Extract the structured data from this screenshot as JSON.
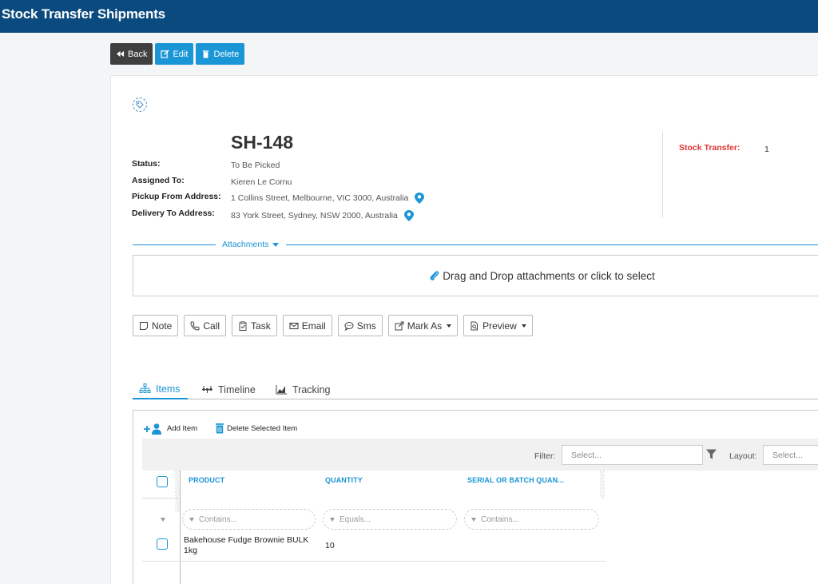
{
  "header": {
    "title": "Stock Transfer Shipments"
  },
  "actions": {
    "back": "Back",
    "edit": "Edit",
    "delete": "Delete"
  },
  "record": {
    "number": "SH-148",
    "fields": [
      {
        "label": "Status:",
        "value": "To Be Picked"
      },
      {
        "label": "Assigned To:",
        "value": "Kieren Le Cornu"
      },
      {
        "label": "Pickup From Address:",
        "value": "1 Collins Street, Melbourne, VIC 3000, Australia"
      },
      {
        "label": "Delivery To Address:",
        "value": "83 York Street, Sydney, NSW 2000, Australia"
      }
    ],
    "stock_transfer": {
      "label": "Stock Transfer:",
      "value": "1"
    }
  },
  "attachments": {
    "label": "Attachments",
    "dropzone": "Drag and Drop attachments or click to select"
  },
  "comm_buttons": {
    "note": "Note",
    "call": "Call",
    "task": "Task",
    "email": "Email",
    "sms": "Sms",
    "mark_as": "Mark As",
    "preview": "Preview"
  },
  "tabs": {
    "items": "Items",
    "timeline": "Timeline",
    "tracking": "Tracking"
  },
  "toolbar": {
    "add": "Add Item",
    "delete": "Delete Selected Item"
  },
  "grid": {
    "filter_label": "Filter:",
    "filter_placeholder": "Select...",
    "layout_label": "Layout:",
    "layout_placeholder": "Select...",
    "columns": [
      "PRODUCT",
      "QUANTITY",
      "SERIAL OR BATCH QUAN..."
    ],
    "filters": [
      "Contains...",
      "Equals...",
      "Contains..."
    ],
    "rows": [
      {
        "product": "Bakehouse Fudge Brownie BULK 1kg",
        "quantity": "10",
        "serial": ""
      }
    ]
  },
  "colors": {
    "header_bg": "#0a4a7e",
    "accent": "#1a95d6",
    "back_btn": "#3f3f3f",
    "stock_label": "#dd3333"
  }
}
